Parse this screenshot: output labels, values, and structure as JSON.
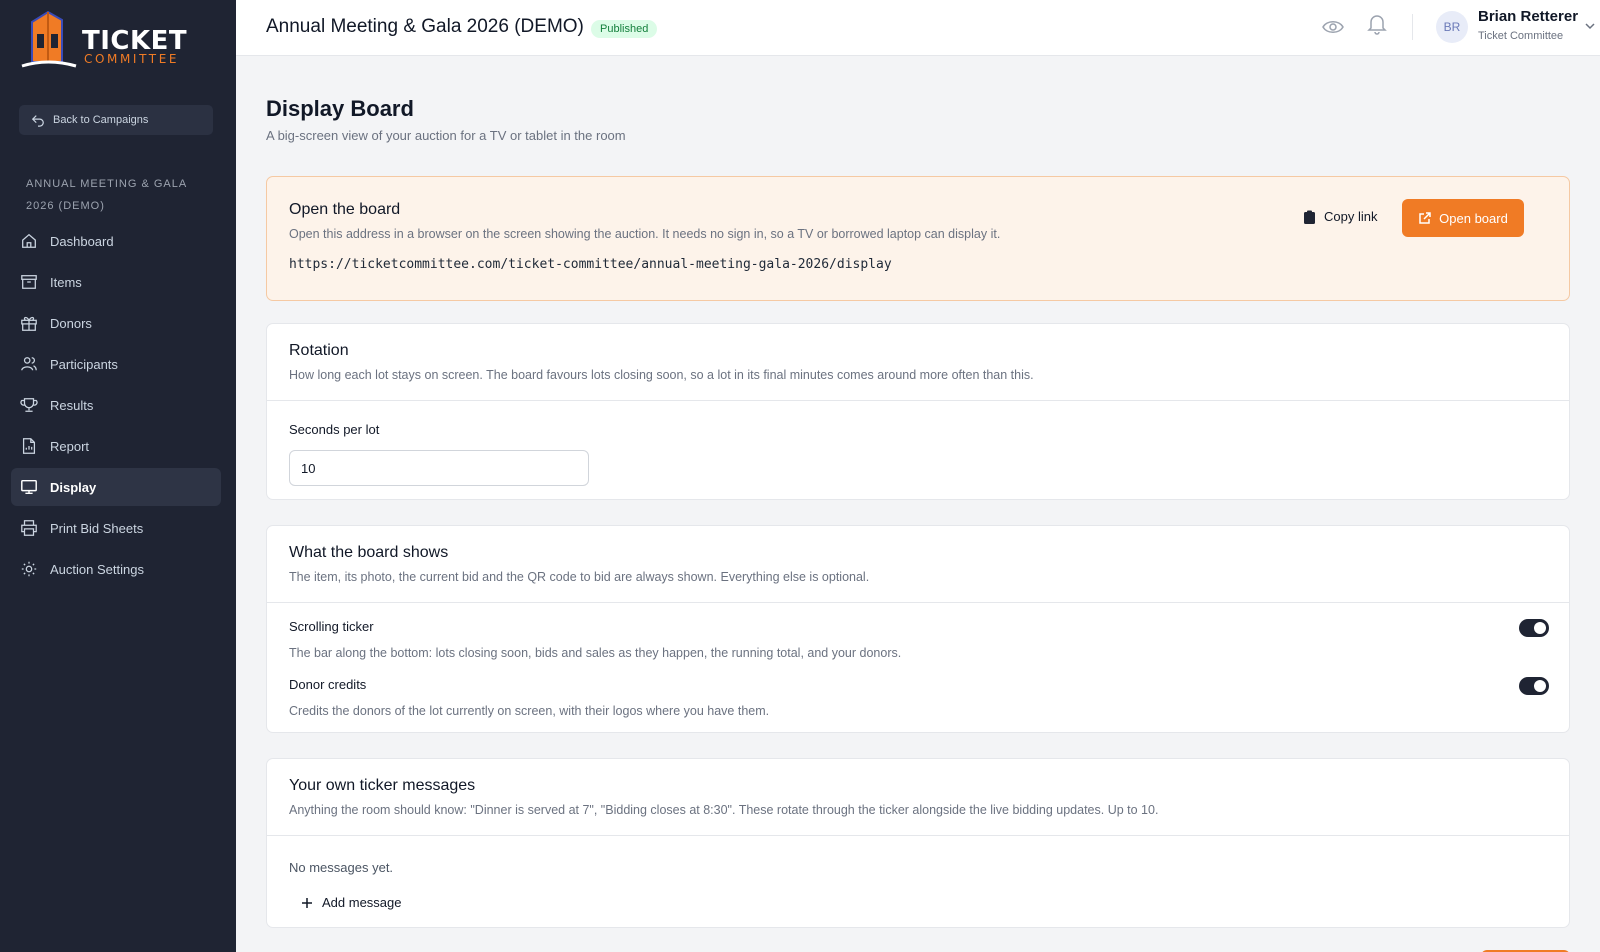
{
  "brand": {
    "line1": "TICKET",
    "line2": "COMMITTEE",
    "accent": "#f07b25",
    "sidebar_bg": "#1f2433"
  },
  "sidebar": {
    "back_label": "Back to Campaigns",
    "campaign_name": "ANNUAL MEETING & GALA 2026 (DEMO)",
    "items": [
      {
        "label": "Dashboard",
        "icon": "home-icon"
      },
      {
        "label": "Items",
        "icon": "archive-icon"
      },
      {
        "label": "Donors",
        "icon": "gift-icon"
      },
      {
        "label": "Participants",
        "icon": "users-icon"
      },
      {
        "label": "Results",
        "icon": "trophy-icon"
      },
      {
        "label": "Report",
        "icon": "document-icon"
      },
      {
        "label": "Display",
        "icon": "monitor-icon",
        "active": true
      },
      {
        "label": "Print Bid Sheets",
        "icon": "printer-icon"
      },
      {
        "label": "Auction Settings",
        "icon": "gear-icon"
      }
    ]
  },
  "header": {
    "title": "Annual Meeting & Gala 2026 (DEMO)",
    "status": "Published",
    "user": {
      "initials": "BR",
      "name": "Brian Retterer",
      "org": "Ticket Committee"
    }
  },
  "page": {
    "title": "Display Board",
    "subtitle": "A big-screen view of your auction for a TV or tablet in the room"
  },
  "open_board": {
    "title": "Open the board",
    "description": "Open this address in a browser on the screen showing the auction. It needs no sign in, so a TV or borrowed laptop can display it.",
    "url": "https://ticketcommittee.com/ticket-committee/annual-meeting-gala-2026/display",
    "copy_label": "Copy link",
    "open_label": "Open board"
  },
  "rotation": {
    "title": "Rotation",
    "description": "How long each lot stays on screen. The board favours lots closing soon, so a lot in its final minutes comes around more often than this.",
    "field_label": "Seconds per lot",
    "value": "10"
  },
  "shows": {
    "title": "What the board shows",
    "description": "The item, its photo, the current bid and the QR code to bid are always shown. Everything else is optional.",
    "toggles": [
      {
        "label": "Scrolling ticker",
        "description": "The bar along the bottom: lots closing soon, bids and sales as they happen, the running total, and your donors.",
        "on": true
      },
      {
        "label": "Donor credits",
        "description": "Credits the donors of the lot currently on screen, with their logos where you have them.",
        "on": true
      }
    ]
  },
  "messages": {
    "title": "Your own ticker messages",
    "description": "Anything the room should know: \"Dinner is served at 7\", \"Bidding closes at 8:30\". These rotate through the ticker alongside the live bidding updates. Up to 10.",
    "empty": "No messages yet.",
    "add_label": "Add message"
  }
}
